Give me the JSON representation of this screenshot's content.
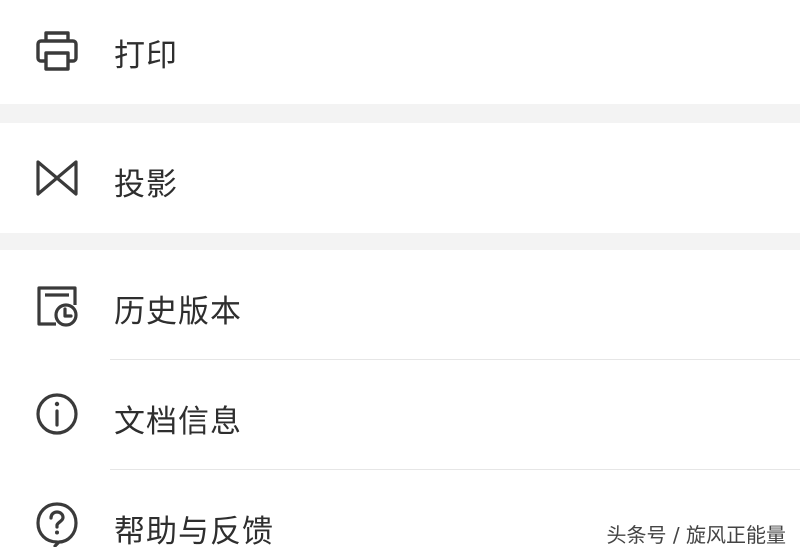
{
  "menu": {
    "items": [
      {
        "label": "打印",
        "icon": "printer-icon"
      },
      {
        "label": "投影",
        "icon": "projection-icon"
      },
      {
        "label": "历史版本",
        "icon": "history-version-icon"
      },
      {
        "label": "文档信息",
        "icon": "info-icon"
      },
      {
        "label": "帮助与反馈",
        "icon": "help-icon"
      }
    ]
  },
  "watermark": {
    "text": "头条号 / 旋风正能量"
  },
  "colors": {
    "text": "#2e2e2e",
    "icon": "#3a3a3a",
    "separator_band": "#f3f3f3",
    "divider": "#e6e6e6",
    "background": "#ffffff"
  }
}
